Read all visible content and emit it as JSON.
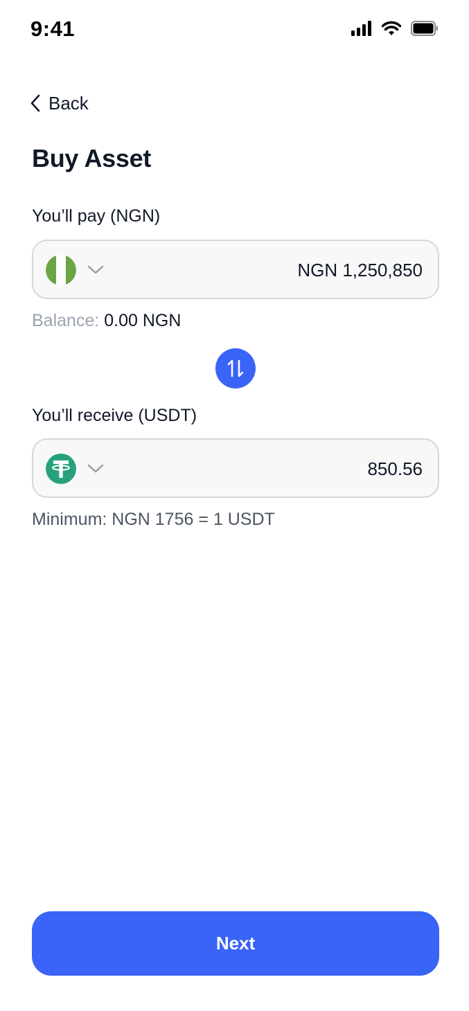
{
  "status_bar": {
    "time": "9:41",
    "icons": [
      "signal-icon",
      "wifi-icon",
      "battery-icon"
    ]
  },
  "nav": {
    "back_label": "Back",
    "back_icon": "chevron-left-icon"
  },
  "page": {
    "title": "Buy Asset"
  },
  "pay": {
    "label": "You’ll pay (NGN)",
    "currency_icon": "nigeria-flag-icon",
    "dropdown_icon": "chevron-down-icon",
    "amount": "NGN 1,250,850",
    "balance_label": "Balance:",
    "balance_value": "0.00 NGN"
  },
  "swap": {
    "icon": "swap-arrows-icon"
  },
  "receive": {
    "label": "You’ll receive (USDT)",
    "currency_icon": "tether-icon",
    "dropdown_icon": "chevron-down-icon",
    "amount": "850.56",
    "minimum": "Minimum: NGN 1756 = 1 USDT"
  },
  "actions": {
    "next_label": "Next"
  },
  "colors": {
    "primary": "#3A63F7",
    "field_bg": "#F8F8F9",
    "field_border": "#D5D7DD",
    "muted_text": "#9CA3AF",
    "nigeria_green": "#6BA544",
    "tether_green": "#26A17B"
  }
}
